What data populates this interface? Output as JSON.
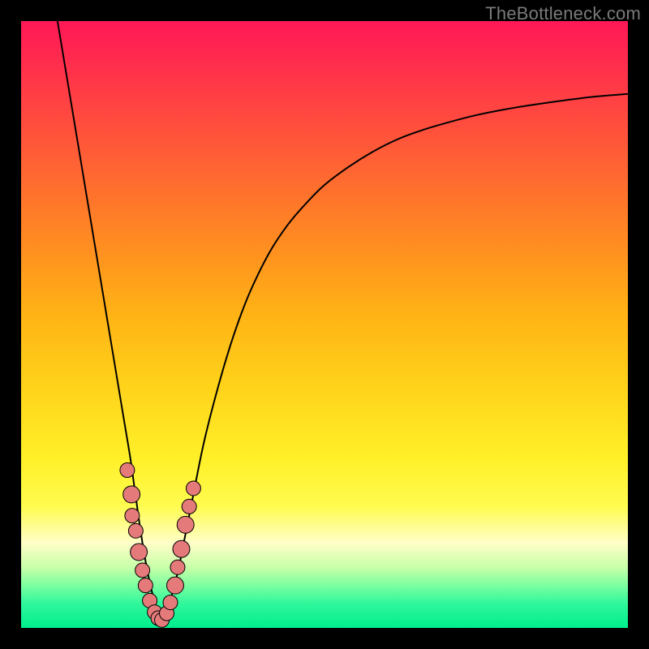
{
  "watermark": "TheBottleneck.com",
  "colors": {
    "frame": "#000000",
    "curve": "#000000",
    "marker_fill": "#e47a7a",
    "marker_stroke": "#000000",
    "gradient_stops": [
      "#ff1856",
      "#ff2a4e",
      "#ff4a3f",
      "#ff6a30",
      "#ff8a22",
      "#ffb215",
      "#ffd21a",
      "#fff028",
      "#fffc50",
      "#fffec8",
      "#c8ffa8",
      "#7cffa0",
      "#30f79c",
      "#00ee8c"
    ]
  },
  "chart_data": {
    "type": "line",
    "title": "",
    "xlabel": "",
    "ylabel": "",
    "xlim": [
      0,
      100
    ],
    "ylim": [
      0,
      100
    ],
    "left_branch": {
      "x": [
        6,
        8,
        10,
        12,
        14,
        15,
        16,
        17,
        18,
        18.7,
        19.4,
        20,
        20.6,
        21.2,
        21.8,
        22.4,
        23
      ],
      "y": [
        100,
        88,
        76,
        64,
        52,
        46,
        40,
        34,
        28,
        23,
        18,
        14,
        10.5,
        7.5,
        5,
        2.8,
        1
      ]
    },
    "right_branch": {
      "x": [
        23,
        24,
        25,
        26,
        27,
        28,
        30,
        32,
        34,
        36,
        38,
        41,
        44,
        47,
        50,
        54,
        58,
        62,
        66,
        70,
        75,
        80,
        85,
        90,
        95,
        100
      ],
      "y": [
        1,
        3,
        6,
        10,
        15,
        20,
        30,
        38,
        45,
        51,
        56,
        62,
        66.5,
        70,
        73,
        76,
        78.5,
        80.5,
        82,
        83.2,
        84.5,
        85.5,
        86.3,
        87,
        87.6,
        88
      ]
    },
    "markers": [
      {
        "x": 17.5,
        "y": 26,
        "r": 1.2
      },
      {
        "x": 18.2,
        "y": 22,
        "r": 1.4
      },
      {
        "x": 18.3,
        "y": 18.5,
        "r": 1.2
      },
      {
        "x": 18.9,
        "y": 16,
        "r": 1.2
      },
      {
        "x": 19.4,
        "y": 12.5,
        "r": 1.4
      },
      {
        "x": 20.0,
        "y": 9.5,
        "r": 1.2
      },
      {
        "x": 20.5,
        "y": 7,
        "r": 1.2
      },
      {
        "x": 21.2,
        "y": 4.5,
        "r": 1.2
      },
      {
        "x": 22.0,
        "y": 2.6,
        "r": 1.2
      },
      {
        "x": 22.6,
        "y": 1.6,
        "r": 1.2
      },
      {
        "x": 23.2,
        "y": 1.3,
        "r": 1.2
      },
      {
        "x": 24.0,
        "y": 2.4,
        "r": 1.2
      },
      {
        "x": 24.6,
        "y": 4.2,
        "r": 1.2
      },
      {
        "x": 25.4,
        "y": 7,
        "r": 1.4
      },
      {
        "x": 25.8,
        "y": 10,
        "r": 1.2
      },
      {
        "x": 26.4,
        "y": 13,
        "r": 1.4
      },
      {
        "x": 27.1,
        "y": 17,
        "r": 1.4
      },
      {
        "x": 27.7,
        "y": 20,
        "r": 1.2
      },
      {
        "x": 28.4,
        "y": 23,
        "r": 1.2
      }
    ]
  }
}
